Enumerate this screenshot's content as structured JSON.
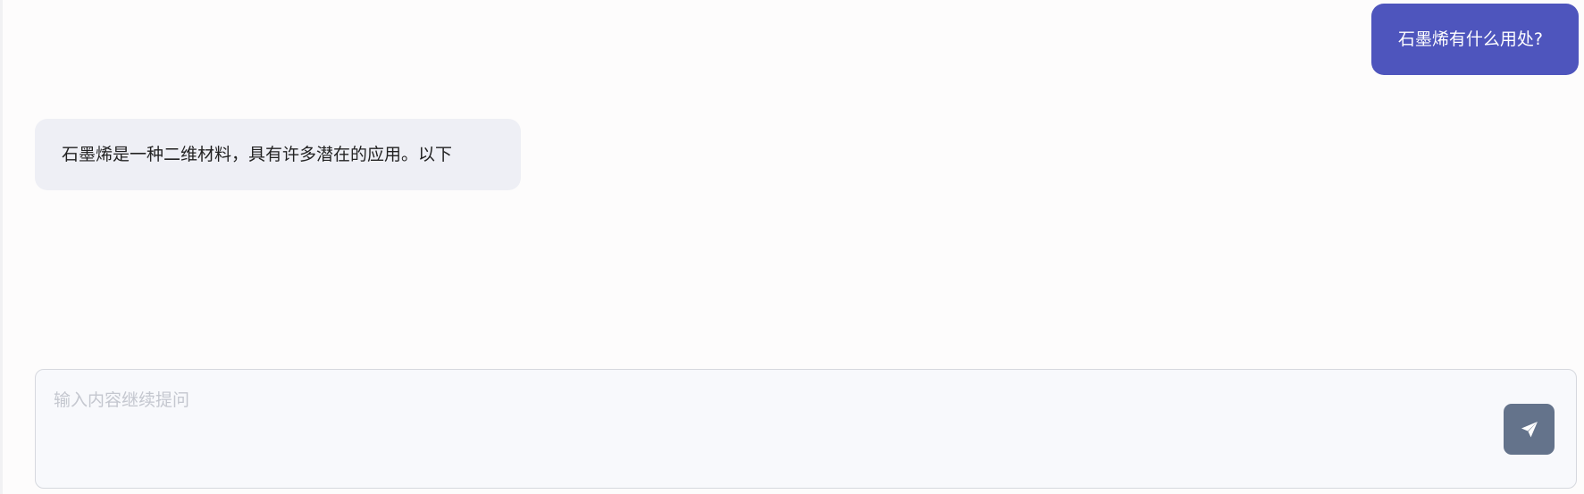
{
  "conversation": {
    "messages": [
      {
        "role": "user",
        "text": "石墨烯有什么用处?"
      },
      {
        "role": "assistant",
        "text": "石墨烯是一种二维材料，具有许多潜在的应用。以下"
      }
    ]
  },
  "composer": {
    "placeholder": "输入内容继续提问",
    "value": "",
    "send_icon": "send-icon"
  },
  "colors": {
    "user_bubble": "#4e55bd",
    "assistant_bubble": "#eeeff5",
    "send_button": "#64738b"
  }
}
